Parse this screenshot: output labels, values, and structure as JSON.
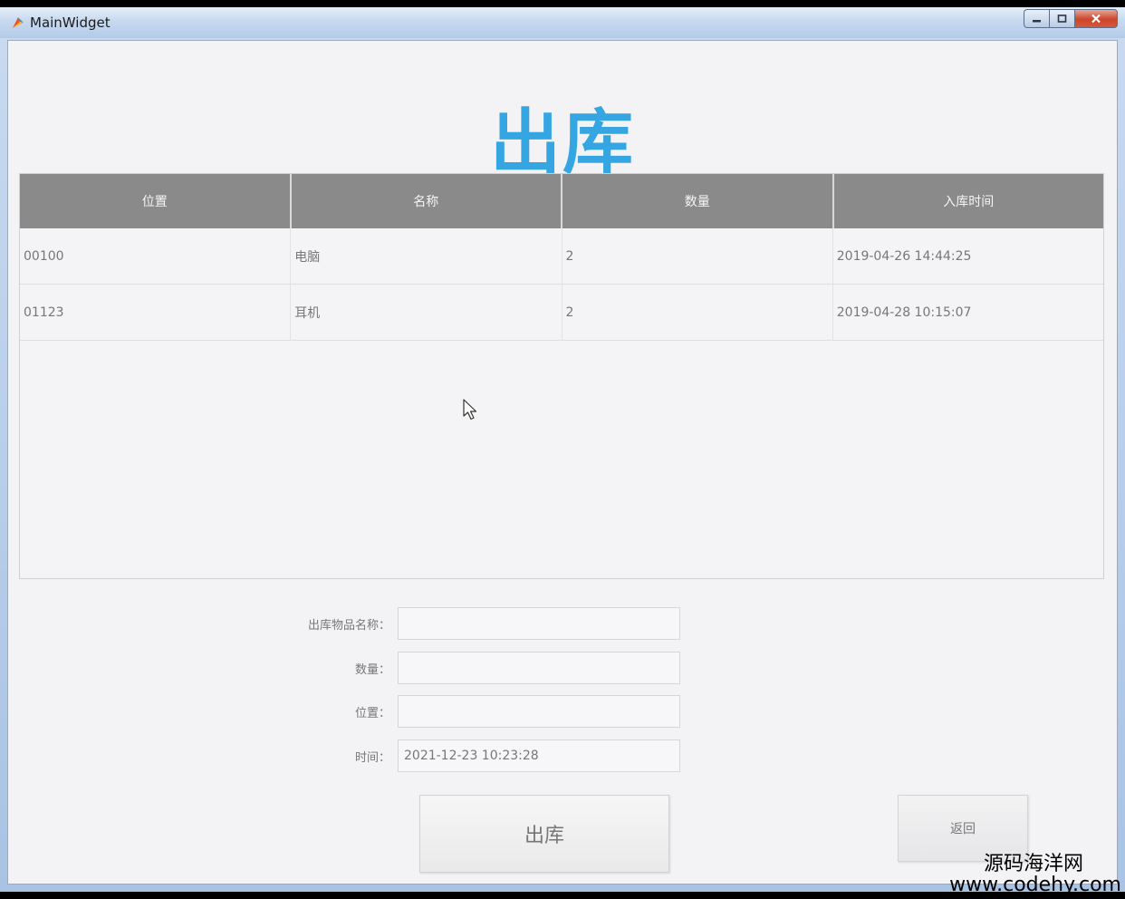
{
  "window": {
    "title": "MainWidget"
  },
  "page": {
    "title": "出库"
  },
  "table": {
    "headers": [
      "位置",
      "名称",
      "数量",
      "入库时间"
    ],
    "rows": [
      [
        "00100",
        "电脑",
        "2",
        "2019-04-26 14:44:25"
      ],
      [
        "01123",
        "耳机",
        "2",
        "2019-04-28 10:15:07"
      ]
    ]
  },
  "form": {
    "name_label": "出库物品名称：",
    "name_value": "",
    "qty_label": "数量：",
    "qty_value": "",
    "location_label": "位置：",
    "location_value": "",
    "time_label": "时间：",
    "time_value": "2021-12-23 10:23:28"
  },
  "buttons": {
    "checkout_label": "出库",
    "back_label": "返回"
  },
  "watermark": {
    "name": "源码海洋网",
    "url": "www.codehy.com"
  },
  "colors": {
    "title_blue": "#36a6e3",
    "header_gray": "#8a8a8a",
    "background": "#f3f3f5"
  }
}
